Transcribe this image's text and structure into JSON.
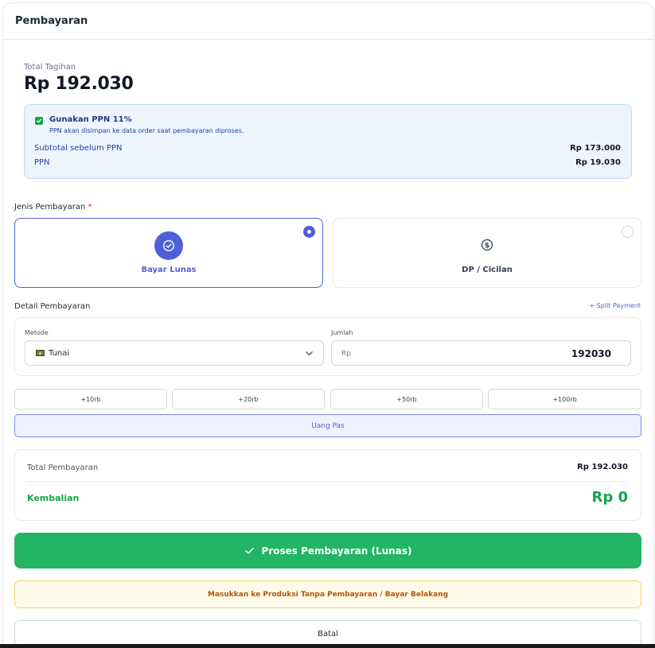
{
  "panel": {
    "title": "Pembayaran"
  },
  "total": {
    "label": "Total Tagihan",
    "amount": "Rp 192.030"
  },
  "ppn": {
    "checked": true,
    "title": "Gunakan PPN 11%",
    "note": "PPN akan disimpan ke data order saat pembayaran diproses.",
    "subtotal_label": "Subtotal sebelum PPN",
    "subtotal_value": "Rp 173.000",
    "ppn_label": "PPN",
    "ppn_value": "Rp 19.030"
  },
  "payment_type": {
    "label": "Jenis Pembayaran",
    "required_mark": "*",
    "options": [
      {
        "label": "Bayar Lunas",
        "selected": true,
        "icon": "check-circle-icon"
      },
      {
        "label": "DP / Cicilan",
        "selected": false,
        "icon": "dollar-circle-icon"
      }
    ]
  },
  "detail": {
    "label": "Detail Pembayaran",
    "split_label": "+ Split Payment",
    "method_label": "Metode",
    "method_value": "Tunai",
    "method_icon": "cash-icon",
    "amount_label": "Jumlah",
    "amount_prefix": "Rp",
    "amount_value": "192030"
  },
  "quick_amounts": [
    "+10rb",
    "+20rb",
    "+50rb",
    "+100rb"
  ],
  "exact_label": "Uang Pas",
  "summary": {
    "total_label": "Total Pembayaran",
    "total_value": "Rp 192.030",
    "change_label": "Kembalian",
    "change_value": "Rp 0"
  },
  "actions": {
    "process_label": "Proses Pembayaran (Lunas)",
    "production_label": "Masukkan ke Produksi Tanpa Pembayaran / Bayar Belakang",
    "cancel_label": "Batal"
  },
  "colors": {
    "accent": "#4f5fd8",
    "success": "#22b565",
    "warning_text": "#b45309",
    "info_bg": "#eef5fe"
  }
}
